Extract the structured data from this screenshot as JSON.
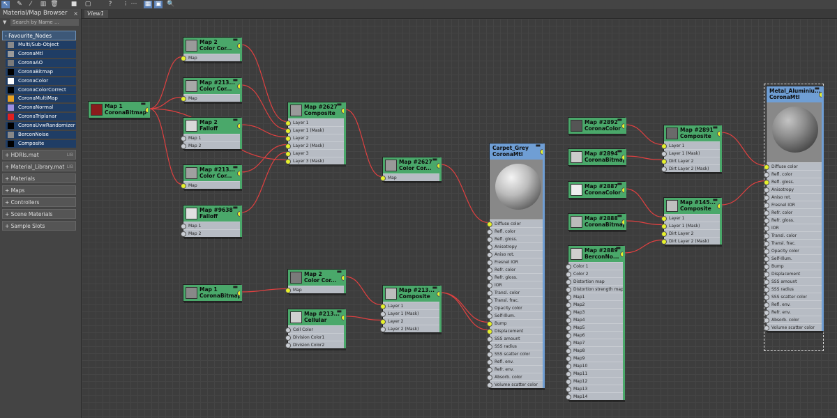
{
  "toolbar": {
    "buttons": [
      {
        "name": "select-tool-icon",
        "glyph": "↖",
        "active": true
      },
      {
        "name": "pick-icon",
        "glyph": "✎",
        "active": false
      },
      {
        "name": "eyedropper-icon",
        "glyph": "⁄",
        "active": false
      },
      {
        "name": "layout-icon",
        "glyph": "▥",
        "active": false
      },
      {
        "name": "delete-icon",
        "glyph": "🗑",
        "active": false
      },
      {
        "name": "square-icon",
        "glyph": "■",
        "active": false
      },
      {
        "name": "frame-icon",
        "glyph": "▢",
        "active": false
      },
      {
        "name": "help-icon",
        "glyph": "?",
        "active": false
      },
      {
        "name": "arrange-icon",
        "glyph": "⁝",
        "active": false
      },
      {
        "name": "hide-unused-icon",
        "glyph": "⋯",
        "active": false
      },
      {
        "name": "grid-view-icon",
        "glyph": "▦",
        "active": true
      },
      {
        "name": "render-icon",
        "glyph": "▣",
        "active": true
      },
      {
        "name": "zoom-icon",
        "glyph": "🔍",
        "active": false
      }
    ]
  },
  "browser": {
    "title": "Material/Map Browser",
    "close": "×",
    "search_placeholder": "Search by Name ...",
    "favourites": {
      "label": "- Favourite_Nodes",
      "items": [
        {
          "label": "Multi/Sub-Object",
          "color": "#8a8a8a"
        },
        {
          "label": "CoronaMtl",
          "color": "#9a9a9a"
        },
        {
          "label": "CoronaAO",
          "color": "#7a7a7a"
        },
        {
          "label": "CoronaBitmap",
          "color": "#000000"
        },
        {
          "label": "CoronaColor",
          "color": "#ffffff"
        },
        {
          "label": "CoronaColorCorrect",
          "color": "#000000"
        },
        {
          "label": "CoronaMultiMap",
          "color": "#e8a020"
        },
        {
          "label": "CoronaNormal",
          "color": "#9c8ee0"
        },
        {
          "label": "CoronaTriplanar",
          "color": "#e02020"
        },
        {
          "label": "CoronaUvwRandomizer",
          "color": "#000000"
        },
        {
          "label": "BerconNoise",
          "color": "#888888"
        },
        {
          "label": "Composite",
          "color": "#000000"
        }
      ]
    },
    "rollouts": [
      {
        "label": "+ HDRIs.mat",
        "lib": "LIB"
      },
      {
        "label": "+ Material_Library.mat",
        "lib": "LIB"
      },
      {
        "label": "+ Materials",
        "lib": ""
      },
      {
        "label": "+ Maps",
        "lib": ""
      },
      {
        "label": "+ Controllers",
        "lib": ""
      },
      {
        "label": "+ Scene Materials",
        "lib": ""
      },
      {
        "label": "+ Sample Slots",
        "lib": ""
      }
    ]
  },
  "view": {
    "tab_label": "View1"
  },
  "nodes": [
    {
      "id": "bitmap-sel",
      "title": "Map 1",
      "subtitle": "CoronaBitmap",
      "kind": "map",
      "thumb": "#8a1c1c",
      "slots": []
    },
    {
      "id": "cc1",
      "title": "Map 2",
      "subtitle": "Color Cor...",
      "kind": "map",
      "thumb": "#9a9a9a",
      "slots": [
        {
          "label": "Map",
          "on": true
        }
      ]
    },
    {
      "id": "cc2",
      "title": "Map #213...",
      "subtitle": "Color Cor...",
      "kind": "map",
      "thumb": "#a8a8a8",
      "slots": [
        {
          "label": "Map",
          "on": true
        }
      ]
    },
    {
      "id": "falloff1",
      "title": "Map 2",
      "subtitle": "Falloff",
      "kind": "map",
      "thumb": "#d8d8d8",
      "slots": [
        {
          "label": "Map 1",
          "on": false
        },
        {
          "label": "Map 2",
          "on": false
        }
      ]
    },
    {
      "id": "cc3",
      "title": "Map #213...",
      "subtitle": "Color Cor...",
      "kind": "map",
      "thumb": "#a0a0a0",
      "slots": [
        {
          "label": "Map",
          "on": true
        }
      ]
    },
    {
      "id": "falloff2",
      "title": "Map #9638",
      "subtitle": "Falloff",
      "kind": "map",
      "thumb": "#e0e0e0",
      "slots": [
        {
          "label": "Map 1",
          "on": false
        },
        {
          "label": "Map 2",
          "on": false
        }
      ]
    },
    {
      "id": "comp1",
      "title": "Map #2627",
      "subtitle": "Composite",
      "kind": "map",
      "thumb": "#9a9a9a",
      "slots": [
        {
          "label": "Layer 1",
          "on": true
        },
        {
          "label": "Layer 1 (Mask)",
          "on": true
        },
        {
          "label": "Layer 2",
          "on": true
        },
        {
          "label": "Layer 2 (Mask)",
          "on": true
        },
        {
          "label": "Layer 3",
          "on": true
        },
        {
          "label": "Layer 3 (Mask)",
          "on": true
        }
      ]
    },
    {
      "id": "cc4",
      "title": "Map #2627",
      "subtitle": "Color Cor...",
      "kind": "map",
      "thumb": "#999999",
      "slots": [
        {
          "label": "Map",
          "on": true
        }
      ]
    },
    {
      "id": "bitmap2",
      "title": "Map 1",
      "subtitle": "CoronaBitmap",
      "kind": "map",
      "thumb": "#888888",
      "slots": []
    },
    {
      "id": "cc5",
      "title": "Map 2",
      "subtitle": "Color Cor...",
      "kind": "map",
      "thumb": "#7a7a7a",
      "slots": [
        {
          "label": "Map",
          "on": true
        }
      ]
    },
    {
      "id": "cellular",
      "title": "Map #213...",
      "subtitle": "Cellular",
      "kind": "map",
      "thumb": "#d0d0d0",
      "slots": [
        {
          "label": "Cell Color",
          "on": false
        },
        {
          "label": "Division Color1",
          "on": false
        },
        {
          "label": "Division Color2",
          "on": false
        }
      ]
    },
    {
      "id": "comp2",
      "title": "Map #213...",
      "subtitle": "Composite",
      "kind": "map",
      "thumb": "#bdbdbd",
      "slots": [
        {
          "label": "Layer 1",
          "on": true
        },
        {
          "label": "Layer 1 (Mask)",
          "on": false
        },
        {
          "label": "Layer 2",
          "on": true
        },
        {
          "label": "Layer 2 (Mask)",
          "on": false
        }
      ]
    },
    {
      "id": "carpet",
      "title": "Carpet_Grey",
      "subtitle": "CoronaMtl",
      "kind": "mtl",
      "thumb": "carpet",
      "slots": [
        {
          "label": "Diffuse color",
          "on": true
        },
        {
          "label": "Refl. color",
          "on": false
        },
        {
          "label": "Refl. gloss.",
          "on": false
        },
        {
          "label": "Anisotropy",
          "on": false
        },
        {
          "label": "Aniso rot.",
          "on": false
        },
        {
          "label": "Fresnel IOR",
          "on": false
        },
        {
          "label": "Refr. color",
          "on": false
        },
        {
          "label": "Refr. gloss.",
          "on": false
        },
        {
          "label": "IOR",
          "on": false
        },
        {
          "label": "Transl. color",
          "on": false
        },
        {
          "label": "Transl. frac.",
          "on": false
        },
        {
          "label": "Opacity color",
          "on": false
        },
        {
          "label": "Self-Illum.",
          "on": false
        },
        {
          "label": "Bump",
          "on": true
        },
        {
          "label": "Displacement",
          "on": true
        },
        {
          "label": "SSS amount",
          "on": false
        },
        {
          "label": "SSS radius",
          "on": false
        },
        {
          "label": "SSS scatter color",
          "on": false
        },
        {
          "label": "Refl. env.",
          "on": false
        },
        {
          "label": "Refr. env.",
          "on": false
        },
        {
          "label": "Absorb. color",
          "on": false
        },
        {
          "label": "Volume scatter color",
          "on": false
        }
      ]
    },
    {
      "id": "col1",
      "title": "Map #2892",
      "subtitle": "CoronaColor",
      "kind": "map",
      "thumb": "#555555",
      "slots": []
    },
    {
      "id": "bitmap3",
      "title": "Map #2894",
      "subtitle": "CoronaBitmap",
      "kind": "map",
      "thumb": "#cccccc",
      "slots": []
    },
    {
      "id": "col2",
      "title": "Map #2887",
      "subtitle": "CoronaColor",
      "kind": "map",
      "thumb": "#eeeeee",
      "slots": []
    },
    {
      "id": "bitmap4",
      "title": "Map #2888",
      "subtitle": "CoronaBitmap",
      "kind": "map",
      "thumb": "#bbbbbb",
      "slots": []
    },
    {
      "id": "comp3",
      "title": "Map #2891",
      "subtitle": "Composite",
      "kind": "map",
      "thumb": "#6a6a6a",
      "slots": [
        {
          "label": "Layer 1",
          "on": true
        },
        {
          "label": "Layer 1 (Mask)",
          "on": false
        },
        {
          "label": "Dirt Layer 2",
          "on": true
        },
        {
          "label": "Dirt Layer 2 (Mask)",
          "on": false
        }
      ]
    },
    {
      "id": "comp4",
      "title": "Map #145...",
      "subtitle": "Composite",
      "kind": "map",
      "thumb": "#c0c0c0",
      "slots": [
        {
          "label": "Layer 1",
          "on": true
        },
        {
          "label": "Layer 1 (Mask)",
          "on": true
        },
        {
          "label": "Dirt Layer 2",
          "on": true
        },
        {
          "label": "Dirt Layer 2 (Mask)",
          "on": true
        }
      ]
    },
    {
      "id": "bercon",
      "title": "Map #2889",
      "subtitle": "BerconNo...",
      "kind": "map",
      "thumb": "#cfcfcf",
      "slots": [
        {
          "label": "Color 1",
          "on": false
        },
        {
          "label": "Color 2",
          "on": false
        },
        {
          "label": "Distortion map",
          "on": false
        },
        {
          "label": "Distortion strength map",
          "on": false
        },
        {
          "label": "Map1",
          "on": false
        },
        {
          "label": "Map2",
          "on": false
        },
        {
          "label": "Map3",
          "on": false
        },
        {
          "label": "Map4",
          "on": false
        },
        {
          "label": "Map5",
          "on": false
        },
        {
          "label": "Map6",
          "on": false
        },
        {
          "label": "Map7",
          "on": false
        },
        {
          "label": "Map8",
          "on": false
        },
        {
          "label": "Map9",
          "on": false
        },
        {
          "label": "Map10",
          "on": false
        },
        {
          "label": "Map11",
          "on": false
        },
        {
          "label": "Map12",
          "on": false
        },
        {
          "label": "Map13",
          "on": false
        },
        {
          "label": "Map14",
          "on": false
        }
      ]
    },
    {
      "id": "metal",
      "title": "Metal_Aluminiu...",
      "subtitle": "CoronaMtl",
      "kind": "mtl",
      "thumb": "metal",
      "slots": [
        {
          "label": "Diffuse color",
          "on": true
        },
        {
          "label": "Refl. color",
          "on": false
        },
        {
          "label": "Refl. gloss.",
          "on": true
        },
        {
          "label": "Anisotropy",
          "on": false
        },
        {
          "label": "Aniso rot.",
          "on": false
        },
        {
          "label": "Fresnel IOR",
          "on": false
        },
        {
          "label": "Refr. color",
          "on": false
        },
        {
          "label": "Refr. gloss.",
          "on": false
        },
        {
          "label": "IOR",
          "on": false
        },
        {
          "label": "Transl. color",
          "on": false
        },
        {
          "label": "Transl. frac.",
          "on": false
        },
        {
          "label": "Opacity color",
          "on": false
        },
        {
          "label": "Self-Illum.",
          "on": false
        },
        {
          "label": "Bump",
          "on": false
        },
        {
          "label": "Displacement",
          "on": false
        },
        {
          "label": "SSS amount",
          "on": false
        },
        {
          "label": "SSS radius",
          "on": false
        },
        {
          "label": "SSS scatter color",
          "on": false
        },
        {
          "label": "Refl. env.",
          "on": false
        },
        {
          "label": "Refr. env.",
          "on": false
        },
        {
          "label": "Absorb. color",
          "on": false
        },
        {
          "label": "Volume scatter color",
          "on": false
        }
      ]
    }
  ],
  "links": [
    [
      "bitmap-sel",
      "cc1",
      0
    ],
    [
      "bitmap-sel",
      "cc2",
      0
    ],
    [
      "bitmap-sel",
      "cc3",
      0
    ],
    [
      "bitmap-sel",
      "comp1",
      5
    ],
    [
      "falloff2",
      "comp1",
      4
    ],
    [
      "cc1",
      "comp1",
      0
    ],
    [
      "cc2",
      "comp1",
      1
    ],
    [
      "falloff1",
      "comp1",
      2
    ],
    [
      "cc3",
      "comp1",
      3
    ],
    [
      "comp1",
      "cc4",
      0
    ],
    [
      "cc4",
      "carpet",
      0
    ],
    [
      "bitmap2",
      "cc5",
      0
    ],
    [
      "cc5",
      "comp2",
      0
    ],
    [
      "cellular",
      "comp2",
      2
    ],
    [
      "comp2",
      "carpet",
      13
    ],
    [
      "comp2",
      "carpet",
      14
    ],
    [
      "col1",
      "comp3",
      0
    ],
    [
      "bitmap3",
      "comp3",
      2
    ],
    [
      "col2",
      "comp4",
      0
    ],
    [
      "bitmap4",
      "comp4",
      1
    ],
    [
      "bercon",
      "comp4",
      3
    ],
    [
      "comp3",
      "metal",
      0
    ],
    [
      "comp4",
      "metal",
      2
    ]
  ],
  "colors": {
    "wire": "#e04040",
    "node_header": "#4aa86a",
    "mtl_header": "#6f9ed4",
    "slot_on": "#e6f02b"
  }
}
